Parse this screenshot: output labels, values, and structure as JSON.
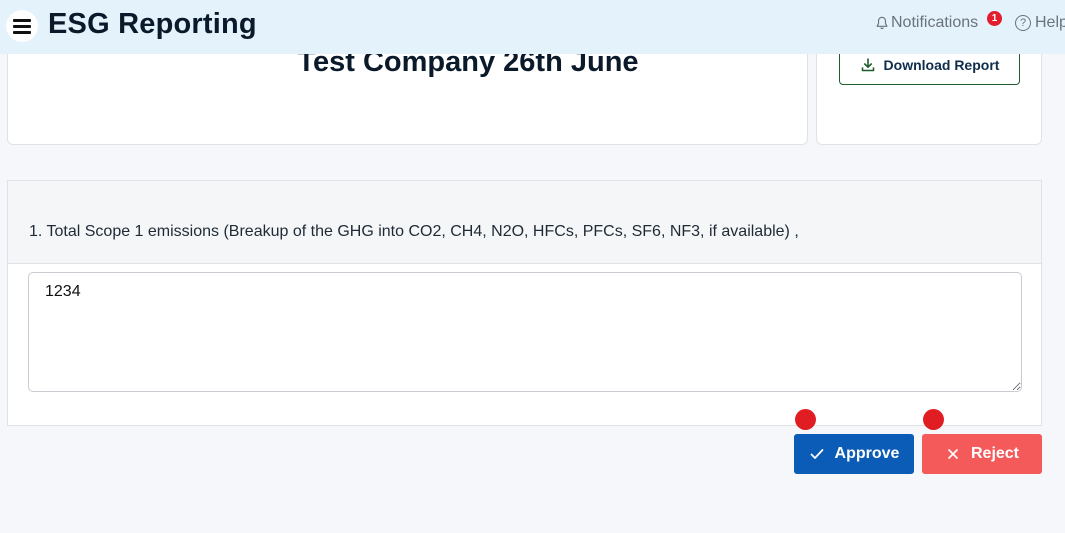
{
  "header": {
    "app_title": "ESG Reporting",
    "notifications_label": "Notifications",
    "notifications_count": "1",
    "help_label": "Help",
    "help_glyph": "?"
  },
  "report": {
    "company_title": "Test Company 26th June",
    "download_label": "Download Report"
  },
  "question": {
    "text": "1. Total Scope 1 emissions (Breakup of the GHG into CO2, CH4, N2O, HFCs, PFCs, SF6, NF3, if available) ,",
    "answer": "1234"
  },
  "actions": {
    "approve_label": "Approve",
    "reject_label": "Reject"
  },
  "colors": {
    "header_bg": "#e3f2fb",
    "approve": "#0b5cb6",
    "reject": "#f55a5a",
    "badge": "#e11d2e"
  }
}
